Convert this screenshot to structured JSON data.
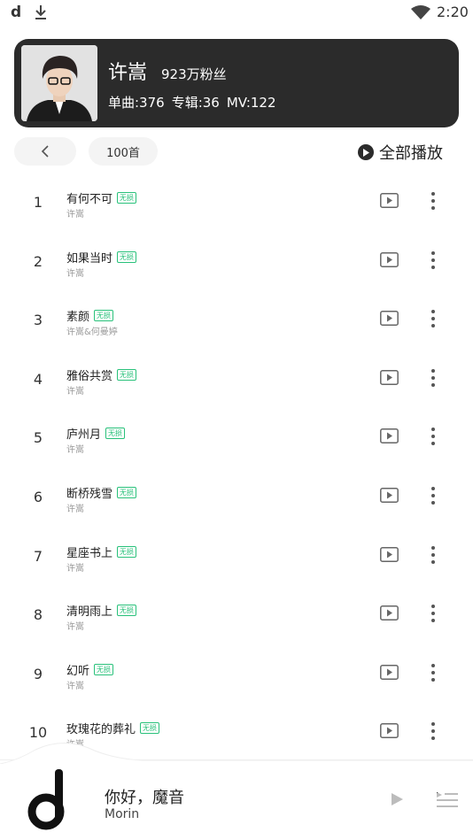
{
  "status_bar": {
    "time": "2:20",
    "app_glyph": "d"
  },
  "artist": {
    "name": "许嵩",
    "fans": "923万粉丝",
    "singles": "单曲:376",
    "albums": "专辑:36",
    "mv": "MV:122"
  },
  "toolbar": {
    "count_label": "100首",
    "play_all_label": "全部播放"
  },
  "songs": [
    {
      "num": "1",
      "title": "有何不可",
      "badge": "无损",
      "artist": "许嵩"
    },
    {
      "num": "2",
      "title": "如果当时",
      "badge": "无损",
      "artist": "许嵩"
    },
    {
      "num": "3",
      "title": "素颜",
      "badge": "无损",
      "artist": "许嵩&何曼婷"
    },
    {
      "num": "4",
      "title": "雅俗共赏",
      "badge": "无损",
      "artist": "许嵩"
    },
    {
      "num": "5",
      "title": "庐州月",
      "badge": "无损",
      "artist": "许嵩"
    },
    {
      "num": "6",
      "title": "断桥残雪",
      "badge": "无损",
      "artist": "许嵩"
    },
    {
      "num": "7",
      "title": "星座书上",
      "badge": "无损",
      "artist": "许嵩"
    },
    {
      "num": "8",
      "title": "清明雨上",
      "badge": "无损",
      "artist": "许嵩"
    },
    {
      "num": "9",
      "title": "幻听",
      "badge": "无损",
      "artist": "许嵩"
    },
    {
      "num": "10",
      "title": "玫瑰花的葬礼",
      "badge": "无损",
      "artist": "许嵩"
    }
  ],
  "player": {
    "title": "你好，魔音",
    "subtitle": "Morin"
  },
  "colors": {
    "card_bg": "#2b2b2b",
    "badge": "#28c17a",
    "text": "#222222"
  }
}
